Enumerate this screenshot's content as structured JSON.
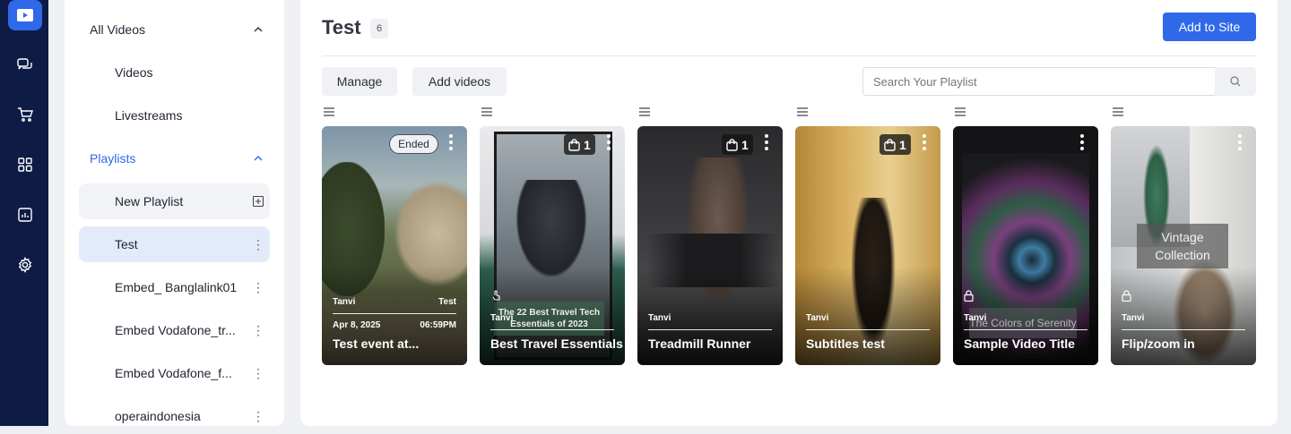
{
  "rail": {
    "items": [
      {
        "icon": "video-play-icon",
        "active": true
      },
      {
        "icon": "chat-bubbles-icon",
        "active": false
      },
      {
        "icon": "cart-icon",
        "active": false
      },
      {
        "icon": "grid-icon",
        "active": false
      },
      {
        "icon": "analytics-icon",
        "active": false
      },
      {
        "icon": "gear-icon",
        "active": false
      }
    ]
  },
  "sidebar": {
    "all_videos": "All Videos",
    "videos": "Videos",
    "livestreams": "Livestreams",
    "playlists": "Playlists",
    "new_playlist": "New Playlist",
    "items": [
      "Test",
      "Embed_ Banglalink01",
      "Embed Vodafone_tr...",
      "Embed Vodafone_f...",
      "operaindonesia"
    ]
  },
  "header": {
    "title": "Test",
    "count": "6",
    "add_to_site": "Add to Site"
  },
  "toolbar": {
    "manage": "Manage",
    "add_videos": "Add videos",
    "search_placeholder": "Search Your Playlist"
  },
  "cards": [
    {
      "title": "Test event at...",
      "author": "Tanvi",
      "playlist_tag": "Test",
      "date": "Apr 8, 2025",
      "time": "06:59PM",
      "status": "Ended"
    },
    {
      "title": "Best Travel Essentials",
      "author": "Tanvi",
      "product_count": "1",
      "overlay": "The 22 Best Travel Tech Essentials of 2023"
    },
    {
      "title": "Treadmill Runner",
      "author": "Tanvi",
      "product_count": "1"
    },
    {
      "title": "Subtitles test",
      "author": "Tanvi",
      "product_count": "1"
    },
    {
      "title": "Sample Video Title",
      "author": "Tanvi",
      "overlay": "The Colors of Serenity",
      "locked": true
    },
    {
      "title": "Flip/zoom in",
      "author": "Tanvi",
      "overlay": "Vintage Collection",
      "locked": true
    }
  ]
}
